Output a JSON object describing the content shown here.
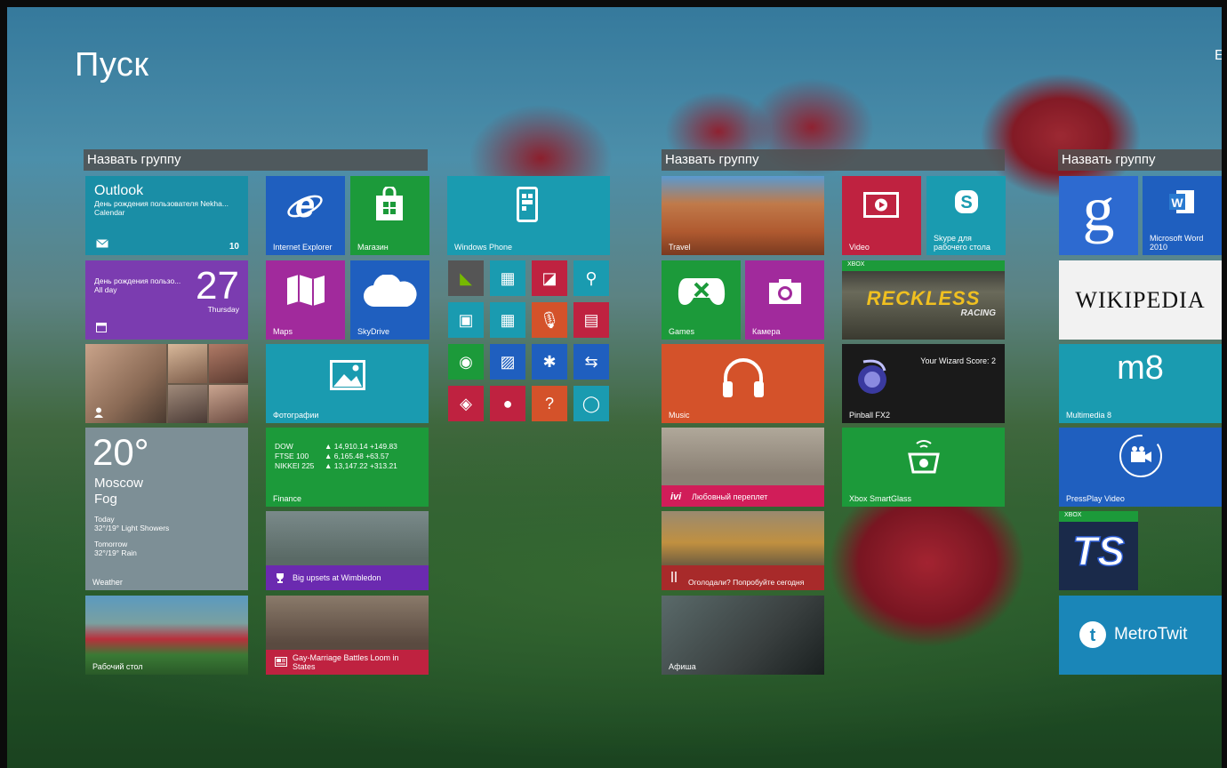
{
  "start": {
    "title": "Пуск",
    "edge_letter": "E"
  },
  "groups": [
    "Назвать группу",
    "Назвать группу",
    "Назвать группу"
  ],
  "tiles": {
    "outlook": {
      "title": "Outlook",
      "line1": "День рождения пользователя Nekha...",
      "line2": "Calendar",
      "count": "10"
    },
    "calendar": {
      "event": "День рождения пользо...",
      "allday": "All day",
      "day": "27",
      "weekday": "Thursday"
    },
    "weather": {
      "temp": "20°",
      "city": "Moscow",
      "cond": "Fog",
      "today_label": "Today",
      "today": "32°/19° Light Showers",
      "tomorrow_label": "Tomorrow",
      "tomorrow": "32°/19° Rain",
      "label": "Weather"
    },
    "desktop": {
      "label": "Рабочий стол"
    },
    "ie": {
      "label": "Internet Explorer"
    },
    "store": {
      "label": "Магазин"
    },
    "maps": {
      "label": "Maps"
    },
    "skydrive": {
      "label": "SkyDrive"
    },
    "photos": {
      "label": "Фотографии"
    },
    "finance": {
      "rows": [
        {
          "name": "DOW",
          "value": "▲ 14,910.14 +149.83"
        },
        {
          "name": "FTSE 100",
          "value": "▲ 6,165.48 +63.57"
        },
        {
          "name": "NIKKEI 225",
          "value": "▲ 13,147.22 +313.21"
        }
      ],
      "label": "Finance"
    },
    "sports": {
      "headline": "Big upsets at Wimbledon"
    },
    "news": {
      "headline": "Gay-Marriage Battles Loom in States"
    },
    "windows_phone": {
      "label": "Windows Phone"
    },
    "travel": {
      "label": "Travel"
    },
    "video": {
      "label": "Video"
    },
    "skype": {
      "label": "Skype для рабочего стола"
    },
    "games": {
      "label": "Games"
    },
    "camera": {
      "label": "Камера"
    },
    "reckless": {
      "badge": "XBOX",
      "logo_top": "RECKLESS",
      "logo_bottom": "RACING"
    },
    "music": {
      "label": "Music"
    },
    "pinball": {
      "score": "Your Wizard Score: 2",
      "label": "Pinball FX2"
    },
    "ivi": {
      "brand": "ivi",
      "title": "Любовный переплет"
    },
    "smartglass": {
      "label": "Xbox SmartGlass"
    },
    "food": {
      "text": "Оголодали? Попробуйте сегодня"
    },
    "afisha": {
      "label": "Афиша"
    },
    "google": {
      "glyph": "g"
    },
    "word": {
      "label": "Microsoft Word 2010"
    },
    "wikipedia": {
      "text": "WIKIPEDIA"
    },
    "multimedia": {
      "logo": "m8",
      "label": "Multimedia 8"
    },
    "pressplay": {
      "label": "PressPlay Video"
    },
    "ts": {
      "badge": "XBOX",
      "logo": "TS"
    },
    "metrotwit": {
      "label": "MetroTwit"
    }
  },
  "colors": {
    "teal": "#1a9bb0",
    "purple": "#7b3cb0",
    "blue": "#1f5fbf",
    "green": "#1c9a3a",
    "magenta": "#a12a9c",
    "orange": "#d4522a",
    "red": "#bf2240",
    "pink": "#d11d59",
    "gray": "#555555"
  }
}
